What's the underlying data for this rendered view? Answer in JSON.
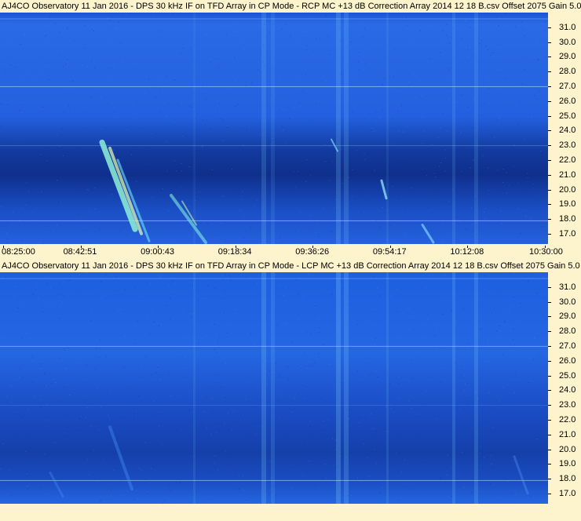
{
  "chart_data": [
    {
      "type": "heatmap",
      "title": "AJ4CO Observatory 11 Jan 2016 - DPS 30 kHz IF on TFD Array in CP Mode - RCP  MC +13 dB  Correction Array 2014 12 18 B.csv  Offset 2075  Gain 5.0",
      "polarization": "RCP",
      "ylabel": "",
      "yticks": [
        "31.0",
        "30.0",
        "29.0",
        "28.0",
        "27.0",
        "26.0",
        "25.0",
        "24.0",
        "23.0",
        "22.0",
        "21.0",
        "20.0",
        "19.0",
        "18.0",
        "17.0"
      ],
      "ytick_values": [
        31,
        30,
        29,
        28,
        27,
        26,
        25,
        24,
        23,
        22,
        21,
        20,
        19,
        18,
        17
      ],
      "ylim": [
        16.3,
        32.0
      ],
      "xticks": [
        "08:25:00",
        "08:42:51",
        "09:00:43",
        "09:18:34",
        "09:36:26",
        "09:54:17",
        "10:12:08",
        "10:30:00"
      ],
      "xlim": [
        "08:25:00",
        "10:30:00"
      ],
      "colors": {
        "low": "#0a1a8a",
        "mid": "#1f5bd8",
        "high": "#6fd6ff",
        "peak": "#e8ffb0"
      }
    },
    {
      "type": "heatmap",
      "title": "AJ4CO Observatory 11 Jan 2016 - DPS 30 kHz IF on TFD Array in CP Mode - LCP  MC +13 dB  Correction Array 2014 12 18 B.csv  Offset 2075  Gain 5.0",
      "polarization": "LCP",
      "ylabel": "",
      "yticks": [
        "31.0",
        "30.0",
        "29.0",
        "28.0",
        "27.0",
        "26.0",
        "25.0",
        "24.0",
        "23.0",
        "22.0",
        "21.0",
        "20.0",
        "19.0",
        "18.0",
        "17.0"
      ],
      "ytick_values": [
        31,
        30,
        29,
        28,
        27,
        26,
        25,
        24,
        23,
        22,
        21,
        20,
        19,
        18,
        17
      ],
      "ylim": [
        16.3,
        32.0
      ],
      "xticks": [],
      "xlim": [
        "08:25:00",
        "10:30:00"
      ],
      "colors": {
        "low": "#0a1a8a",
        "mid": "#1f5bd8",
        "high": "#6fd6ff",
        "peak": "#e8ffb0"
      }
    }
  ]
}
